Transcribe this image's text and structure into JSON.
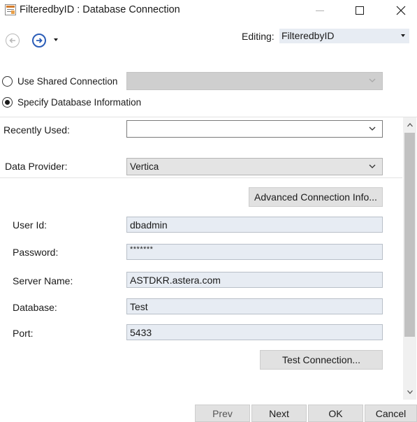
{
  "window": {
    "title": "FilteredbyID : Database Connection"
  },
  "toolbar": {
    "editing_label": "Editing:",
    "editing_value": "FilteredbyID"
  },
  "connection_choice": {
    "shared_label": "Use Shared Connection",
    "shared_selected": false,
    "specify_label": "Specify Database Information",
    "specify_selected": true
  },
  "recently_used": {
    "label": "Recently Used:",
    "value": ""
  },
  "data_provider": {
    "label": "Data Provider:",
    "value": "Vertica"
  },
  "buttons": {
    "advanced": "Advanced Connection Info...",
    "test_connection": "Test Connection..."
  },
  "fields": {
    "user_id": {
      "label": "User Id:",
      "value": "dbadmin"
    },
    "password": {
      "label": "Password:",
      "value": "*******"
    },
    "server_name": {
      "label": "Server Name:",
      "value": "ASTDKR.astera.com"
    },
    "database": {
      "label": "Database:",
      "value": "Test"
    },
    "port": {
      "label": "Port:",
      "value": "5433"
    }
  },
  "footer": {
    "prev": "Prev",
    "next": "Next",
    "ok": "OK",
    "cancel": "Cancel"
  },
  "icons": {
    "app": "database-connection-icon",
    "back": "back-arrow-icon",
    "forward": "forward-arrow-icon"
  },
  "colors": {
    "accent": "#2b5db8",
    "field_bg": "#e7ecf3",
    "button_bg": "#e1e1e1"
  }
}
